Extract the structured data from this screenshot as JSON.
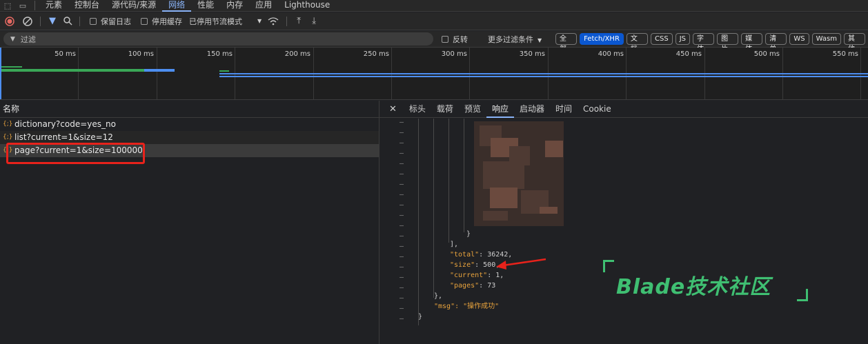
{
  "devtools": {
    "panels": [
      "元素",
      "控制台",
      "源代码/来源",
      "网络",
      "性能",
      "内存",
      "应用",
      "Lighthouse"
    ],
    "active_panel": "网络"
  },
  "toolbar": {
    "preserve_log": "保留日志",
    "disable_cache": "停用缓存",
    "throttle": "已停用节流模式"
  },
  "filter": {
    "placeholder": "过滤",
    "invert": "反转",
    "more_filters": "更多过滤条件",
    "types": [
      "全部",
      "Fetch/XHR",
      "文档",
      "CSS",
      "JS",
      "字体",
      "图片",
      "媒体",
      "清单",
      "WS",
      "Wasm",
      "其他"
    ],
    "active_type": "Fetch/XHR"
  },
  "timeline": {
    "ticks": [
      "50 ms",
      "100 ms",
      "150 ms",
      "200 ms",
      "250 ms",
      "300 ms",
      "350 ms",
      "400 ms",
      "450 ms",
      "500 ms",
      "550 ms"
    ]
  },
  "requests": {
    "header": "名称",
    "items": [
      {
        "name": "dictionary?code=yes_no"
      },
      {
        "name": "list?current=1&size=12"
      },
      {
        "name": "page?current=1&size=100000"
      }
    ]
  },
  "detail": {
    "tabs": [
      "标头",
      "载荷",
      "预览",
      "响应",
      "启动器",
      "时间",
      "Cookie"
    ],
    "active_tab": "响应",
    "close": "✕"
  },
  "response": {
    "lines": [
      {
        "key": "",
        "text": "}"
      },
      {
        "key": "",
        "text": "],"
      },
      {
        "key": "\"total\"",
        "text": ": 36242,"
      },
      {
        "key": "\"size\"",
        "text": ": 500,"
      },
      {
        "key": "\"current\"",
        "text": ": 1,"
      },
      {
        "key": "\"pages\"",
        "text": ": 73"
      },
      {
        "key": "",
        "text": "},"
      },
      {
        "key": "\"msg\"",
        "text": ": \"操作成功\""
      },
      {
        "key": "",
        "text": "}"
      }
    ]
  },
  "watermark": "Blade技术社区",
  "colors": {
    "accent": "#8ab4f8",
    "highlight": "#e8221b",
    "watermark": "#3fbf72"
  }
}
